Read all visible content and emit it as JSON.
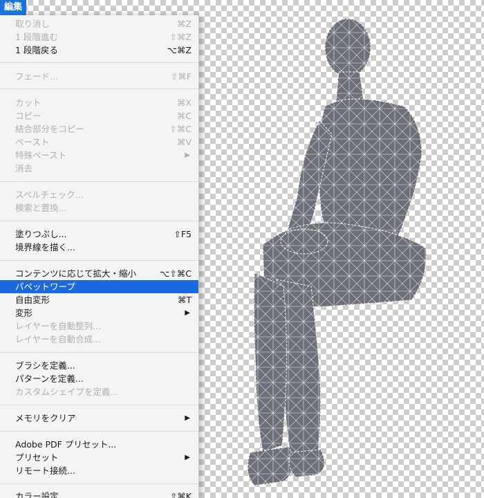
{
  "menu_title": "編集",
  "items": [
    {
      "label": "取り消し",
      "shortcut": "⌘Z",
      "disabled": true
    },
    {
      "label": "1 段階進む",
      "shortcut": "⇧⌘Z",
      "disabled": true
    },
    {
      "label": "1 段階戻る",
      "shortcut": "⌥⌘Z",
      "disabled": false
    },
    {
      "label": "フェード...",
      "shortcut": "⇧⌘F",
      "disabled": true
    },
    {
      "label": "カット",
      "shortcut": "⌘X",
      "disabled": true
    },
    {
      "label": "コピー",
      "shortcut": "⌘C",
      "disabled": true
    },
    {
      "label": "結合部分をコピー",
      "shortcut": "⇧⌘C",
      "disabled": true
    },
    {
      "label": "ペースト",
      "shortcut": "⌘V",
      "disabled": true
    },
    {
      "label": "特殊ペースト",
      "shortcut": "",
      "submenu": true,
      "disabled": true
    },
    {
      "label": "消去",
      "shortcut": "",
      "disabled": true
    },
    {
      "label": "スペルチェック...",
      "shortcut": "",
      "disabled": true
    },
    {
      "label": "検索と置換...",
      "shortcut": "",
      "disabled": true
    },
    {
      "label": "塗りつぶし...",
      "shortcut": "⇧F5",
      "disabled": false
    },
    {
      "label": "境界線を描く...",
      "shortcut": "",
      "disabled": false
    },
    {
      "label": "コンテンツに応じて拡大・縮小",
      "shortcut": "⌥⇧⌘C",
      "disabled": false
    },
    {
      "label": "パペットワープ",
      "shortcut": "",
      "disabled": false,
      "highlighted": true
    },
    {
      "label": "自由変形",
      "shortcut": "⌘T",
      "disabled": false
    },
    {
      "label": "変形",
      "shortcut": "",
      "submenu": true,
      "disabled": false
    },
    {
      "label": "レイヤーを自動整列...",
      "shortcut": "",
      "disabled": true
    },
    {
      "label": "レイヤーを自動合成...",
      "shortcut": "",
      "disabled": true
    },
    {
      "label": "ブラシを定義...",
      "shortcut": "",
      "disabled": false
    },
    {
      "label": "パターンを定義...",
      "shortcut": "",
      "disabled": false
    },
    {
      "label": "カスタムシェイプを定義...",
      "shortcut": "",
      "disabled": true
    },
    {
      "label": "メモリをクリア",
      "shortcut": "",
      "submenu": true,
      "disabled": false
    },
    {
      "label": "Adobe PDF プリセット...",
      "shortcut": "",
      "disabled": false
    },
    {
      "label": "プリセット",
      "shortcut": "",
      "submenu": true,
      "disabled": false
    },
    {
      "label": "リモート接続...",
      "shortcut": "",
      "disabled": false
    },
    {
      "label": "カラー設定...",
      "shortcut": "⇧⌘K",
      "disabled": false
    }
  ],
  "colors": {
    "highlight": "#1b69dc",
    "menu_bg": "#f4f4f4"
  }
}
